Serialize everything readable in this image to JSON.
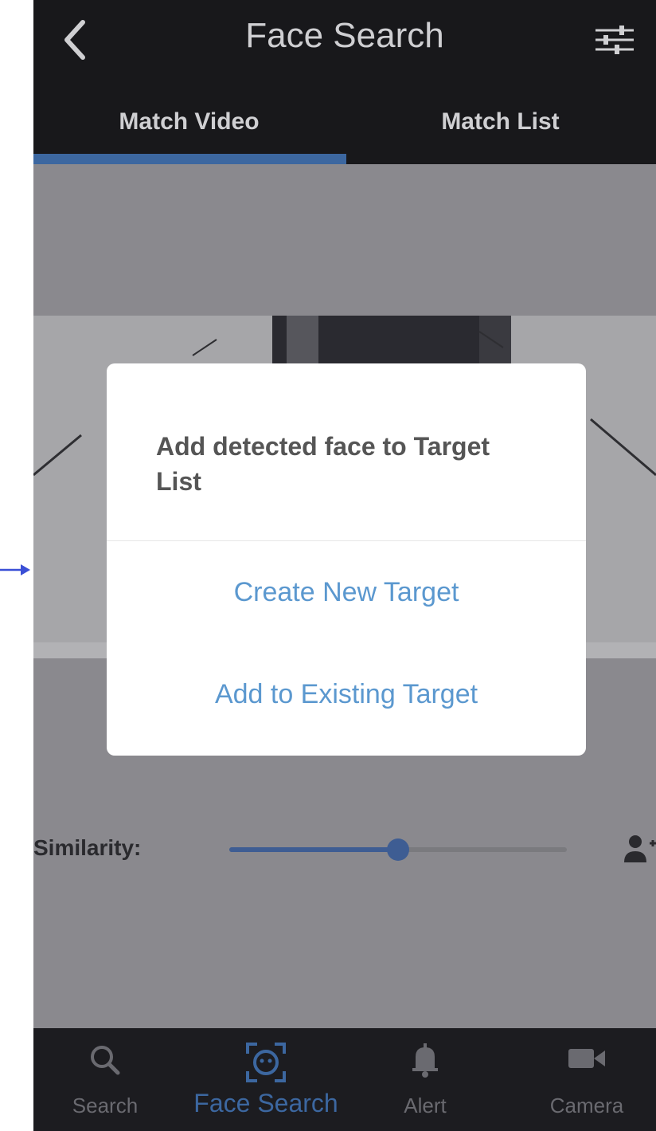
{
  "header": {
    "title": "Face Search"
  },
  "tabs": [
    {
      "label": "Match Video",
      "active": true
    },
    {
      "label": "Match List",
      "active": false
    }
  ],
  "dialog": {
    "title": "Add detected face to Target List",
    "actions": [
      {
        "label": "Create New Target"
      },
      {
        "label": "Add to Existing Target"
      }
    ]
  },
  "similarity": {
    "label": "Similarity:",
    "value": 0.5
  },
  "bottom_nav": [
    {
      "label": "Search",
      "icon": "search-icon"
    },
    {
      "label": "Face Search",
      "icon": "face-scan-icon",
      "active": true
    },
    {
      "label": "Alert",
      "icon": "bell-icon"
    },
    {
      "label": "Camera",
      "icon": "video-camera-icon"
    }
  ],
  "colors": {
    "accent": "#3c67a0",
    "link": "#5b98cf",
    "header_bg": "#18181b",
    "overlay_bg": "#8a898e"
  }
}
